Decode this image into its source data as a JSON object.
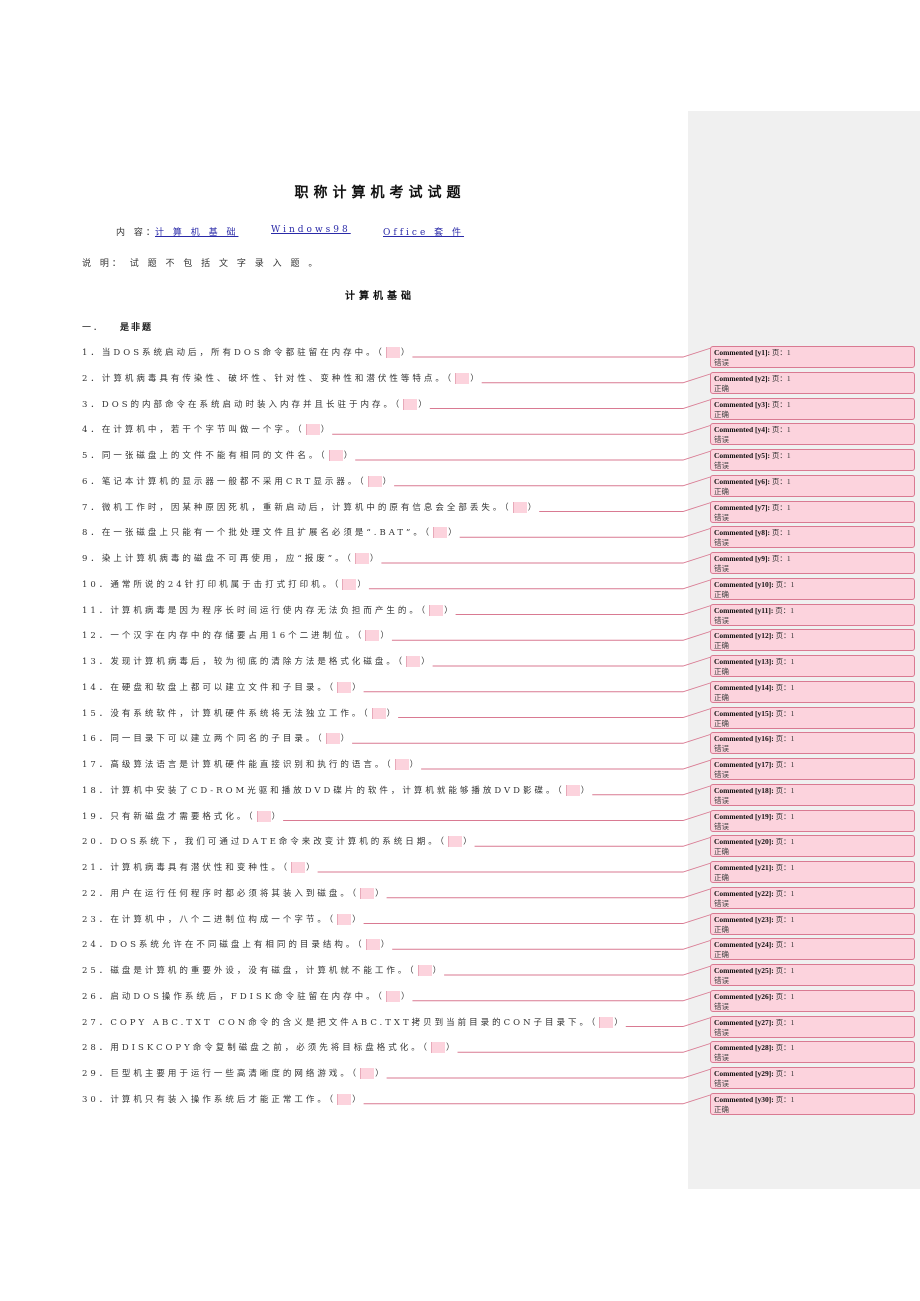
{
  "document": {
    "title": "职称计算机考试试题",
    "contents_label": "内 容：",
    "contents_links": [
      "计 算 机 基 础",
      "Windows98",
      "Office 套 件"
    ],
    "note": "说 明： 试 题 不 包 括 文 字 录 入 题 。",
    "section_title": "计算机基础",
    "part_number": "一．",
    "part_title": "是非题",
    "colors": {
      "answer_highlight": "#fcd3dd",
      "comment_border": "#d97a92",
      "margin_pane": "#f0f0f0",
      "link": "#2a2aa8"
    }
  },
  "questions": [
    {
      "n": "1．",
      "text": "当DOS系统启动后，所有DOS命令都驻留在内存中。（",
      "close": "）"
    },
    {
      "n": "2．",
      "text": "计算机病毒具有传染性、破坏性、针对性、变种性和潜伏性等特点。（",
      "close": "）"
    },
    {
      "n": "3．",
      "text": "DOS的内部命令在系统启动时装入内存并且长驻于内存。（",
      "close": "）"
    },
    {
      "n": "4．",
      "text": "在计算机中，若干个字节叫做一个字。（",
      "close": "）"
    },
    {
      "n": "5．",
      "text": "同一张磁盘上的文件不能有相同的文件名。（",
      "close": "）"
    },
    {
      "n": "6．",
      "text": "笔记本计算机的显示器一般都不采用CRT显示器。（",
      "close": "）"
    },
    {
      "n": "7．",
      "text": "微机工作时，因某种原因死机，重新启动后，计算机中的原有信息会全部丢失。（",
      "close": "）"
    },
    {
      "n": "8．",
      "text": "在一张磁盘上只能有一个批处理文件且扩展名必须是“.BAT”。（",
      "close": "）"
    },
    {
      "n": "9．",
      "text": "染上计算机病毒的磁盘不可再使用，应“报废”。（",
      "close": "）"
    },
    {
      "n": "10．",
      "text": "通常所说的24针打印机属于击打式打印机。（",
      "close": "）"
    },
    {
      "n": "11．",
      "text": "计算机病毒是因为程序长时间运行使内存无法负担而产生的。（",
      "close": "）"
    },
    {
      "n": "12．",
      "text": "一个汉字在内存中的存储要占用16个二进制位。（",
      "close": "）"
    },
    {
      "n": "13．",
      "text": "发现计算机病毒后，较为彻底的清除方法是格式化磁盘。（",
      "close": "）"
    },
    {
      "n": "14．",
      "text": "在硬盘和软盘上都可以建立文件和子目录。（",
      "close": "）"
    },
    {
      "n": "15．",
      "text": "没有系统软件，计算机硬件系统将无法独立工作。（",
      "close": "）"
    },
    {
      "n": "16．",
      "text": "同一目录下可以建立两个同名的子目录。（",
      "close": "）"
    },
    {
      "n": "17．",
      "text": "高级算法语言是计算机硬件能直接识别和执行的语言。（",
      "close": "）"
    },
    {
      "n": "18．",
      "text": "计算机中安装了CD-ROM光驱和播放DVD碟片的软件，计算机就能够播放DVD影碟。（",
      "close": "）"
    },
    {
      "n": "19．",
      "text": "只有新磁盘才需要格式化。（",
      "close": "）"
    },
    {
      "n": "20．",
      "text": "DOS系统下，我们可通过DATE命令来改变计算机的系统日期。（",
      "close": "）"
    },
    {
      "n": "21．",
      "text": "计算机病毒具有潜伏性和变种性。（",
      "close": "）"
    },
    {
      "n": "22．",
      "text": "用户在运行任何程序时都必须将其装入到磁盘。（",
      "close": "）"
    },
    {
      "n": "23．",
      "text": "在计算机中，八个二进制位构成一个字节。（",
      "close": "）"
    },
    {
      "n": "24．",
      "text": "DOS系统允许在不同磁盘上有相同的目录结构。（",
      "close": "）"
    },
    {
      "n": "25．",
      "text": "磁盘是计算机的重要外设，没有磁盘，计算机就不能工作。（",
      "close": "）"
    },
    {
      "n": "26．",
      "text": "启动DOS操作系统后，FDISK命令驻留在内存中。（",
      "close": "）"
    },
    {
      "n": "27．",
      "text": "COPY ABC.TXT CON命令的含义是把文件ABC.TXT拷贝到当前目录的CON子目录下。（",
      "close": "）"
    },
    {
      "n": "28．",
      "text": "用DISKCOPY命令复制磁盘之前，必须先将目标盘格式化。（",
      "close": "）"
    },
    {
      "n": "29．",
      "text": "巨型机主要用于运行一些高清晰度的网络游戏。（",
      "close": "）"
    },
    {
      "n": "30．",
      "text": "计算机只有装入操作系统后才能正常工作。（",
      "close": "）"
    }
  ],
  "comments": [
    {
      "head": "Commented [y1]:",
      "page": "页：1",
      "body": "错误"
    },
    {
      "head": "Commented [y2]:",
      "page": "页：1",
      "body": "正确"
    },
    {
      "head": "Commented [y3]:",
      "page": "页：1",
      "body": "正确"
    },
    {
      "head": "Commented [y4]:",
      "page": "页：1",
      "body": "错误"
    },
    {
      "head": "Commented [y5]:",
      "page": "页：1",
      "body": "错误"
    },
    {
      "head": "Commented [y6]:",
      "page": "页：1",
      "body": "正确"
    },
    {
      "head": "Commented [y7]:",
      "page": "页：1",
      "body": "错误"
    },
    {
      "head": "Commented [y8]:",
      "page": "页：1",
      "body": "错误"
    },
    {
      "head": "Commented [y9]:",
      "page": "页：1",
      "body": "错误"
    },
    {
      "head": "Commented [y10]:",
      "page": "页：1",
      "body": "正确"
    },
    {
      "head": "Commented [y11]:",
      "page": "页：1",
      "body": "错误"
    },
    {
      "head": "Commented [y12]:",
      "page": "页：1",
      "body": "正确"
    },
    {
      "head": "Commented [y13]:",
      "page": "页：1",
      "body": "正确"
    },
    {
      "head": "Commented [y14]:",
      "page": "页：1",
      "body": "正确"
    },
    {
      "head": "Commented [y15]:",
      "page": "页：1",
      "body": "正确"
    },
    {
      "head": "Commented [y16]:",
      "page": "页：1",
      "body": "错误"
    },
    {
      "head": "Commented [y17]:",
      "page": "页：1",
      "body": "错误"
    },
    {
      "head": "Commented [y18]:",
      "page": "页：1",
      "body": "错误"
    },
    {
      "head": "Commented [y19]:",
      "page": "页：1",
      "body": "错误"
    },
    {
      "head": "Commented [y20]:",
      "page": "页：1",
      "body": "正确"
    },
    {
      "head": "Commented [y21]:",
      "page": "页：1",
      "body": "正确"
    },
    {
      "head": "Commented [y22]:",
      "page": "页：1",
      "body": "错误"
    },
    {
      "head": "Commented [y23]:",
      "page": "页：1",
      "body": "正确"
    },
    {
      "head": "Commented [y24]:",
      "page": "页：1",
      "body": "正确"
    },
    {
      "head": "Commented [y25]:",
      "page": "页：1",
      "body": "错误"
    },
    {
      "head": "Commented [y26]:",
      "page": "页：1",
      "body": "错误"
    },
    {
      "head": "Commented [y27]:",
      "page": "页：1",
      "body": "错误"
    },
    {
      "head": "Commented [y28]:",
      "page": "页：1",
      "body": "错误"
    },
    {
      "head": "Commented [y29]:",
      "page": "页：1",
      "body": "错误"
    },
    {
      "head": "Commented [y30]:",
      "page": "页：1",
      "body": "正确"
    }
  ]
}
